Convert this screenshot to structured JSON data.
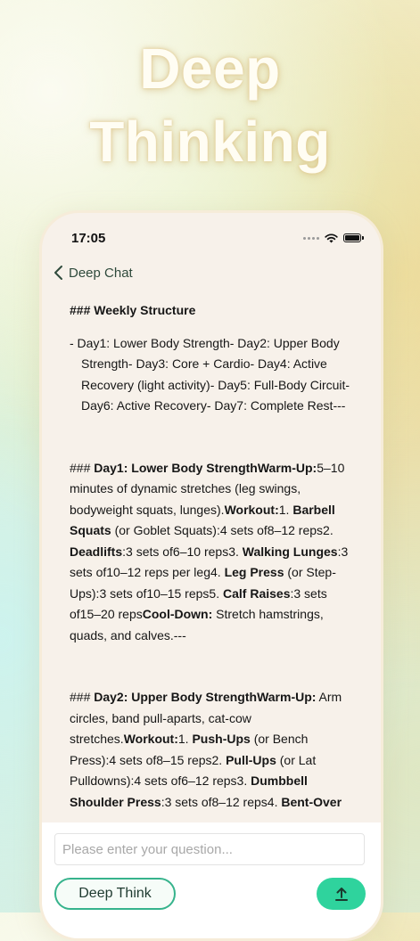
{
  "hero": {
    "line1": "Deep",
    "line2": "Thinking"
  },
  "status_bar": {
    "time": "17:05"
  },
  "nav": {
    "back_label": "Deep Chat"
  },
  "content": {
    "weekly_heading_prefix": "### ",
    "weekly_heading": "Weekly Structure",
    "weekly_list": "- Day1: Lower Body Strength- Day2: Upper Body Strength- Day3: Core + Cardio- Day4: Active Recovery (light activity)- Day5: Full-Body Circuit- Day6: Active Recovery- Day7: Complete Rest---",
    "day1": {
      "prefix": "### ",
      "title": "Day1: Lower Body Strength",
      "warmup_label": "Warm-Up:",
      "warmup_text": "5–10 minutes of dynamic stretches (leg swings, bodyweight squats, lunges).",
      "workout_label": "Workout:",
      "ex1_num": "1. ",
      "ex1_name": "Barbell Squats",
      "ex1_detail": " (or Goblet Squats):4 sets of8–12 reps2. ",
      "ex2_name": "Deadlifts",
      "ex2_detail": ":3 sets of6–10 reps3. ",
      "ex3_name": "Walking Lunges",
      "ex3_detail": ":3 sets of10–12 reps per leg4. ",
      "ex4_name": "Leg Press",
      "ex4_detail": " (or Step-Ups):3 sets of10–15 reps5. ",
      "ex5_name": "Calf Raises",
      "ex5_detail": ":3 sets of15–20 reps",
      "cooldown_label": "Cool-Down:",
      "cooldown_text": " Stretch hamstrings, quads, and calves.---"
    },
    "day2": {
      "prefix": "### ",
      "title": "Day2: Upper Body Strength",
      "warmup_label": "Warm-Up:",
      "warmup_text": " Arm circles, band pull-aparts, cat-cow stretches.",
      "workout_label": "Workout:",
      "ex1_num": "1. ",
      "ex1_name": "Push-Ups",
      "ex1_detail": " (or Bench Press):4 sets of8–15 reps2. ",
      "ex2_name": "Pull-Ups",
      "ex2_detail": " (or Lat Pulldowns):4 sets of6–12 reps3. ",
      "ex3_name": "Dumbbell Shoulder Press",
      "ex3_detail": ":3 sets of8–12 reps4. ",
      "ex4_name": "Bent-Over"
    }
  },
  "input": {
    "placeholder": "Please enter your question..."
  },
  "buttons": {
    "deep_think": "Deep Think"
  },
  "colors": {
    "accent": "#2fd39d",
    "accent_border": "#36b38c",
    "nav_text": "#2f4a3c"
  }
}
